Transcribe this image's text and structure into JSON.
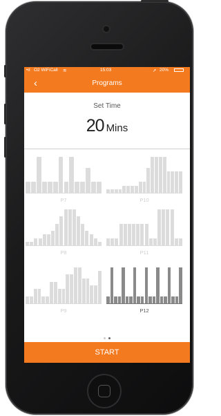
{
  "status_bar": {
    "carrier": "O2 WiFiCall",
    "time": "15:03",
    "battery": "20%"
  },
  "nav": {
    "title": "Programs",
    "back_icon": "chevron-left-icon"
  },
  "set_time": {
    "label": "Set Time",
    "value": "20",
    "unit": "Mins"
  },
  "programs": [
    {
      "id": "P7",
      "label": "P7",
      "selected": false,
      "levels": [
        3,
        3,
        10,
        3,
        3,
        3,
        10,
        3,
        10,
        3,
        3,
        7,
        3,
        3
      ]
    },
    {
      "id": "P10",
      "label": "P10",
      "selected": false,
      "levels": [
        1,
        1,
        1,
        1,
        2,
        2,
        2,
        2,
        3,
        3,
        7,
        10,
        10,
        10,
        10,
        6,
        6,
        6,
        6
      ]
    },
    {
      "id": "P8",
      "label": "P8",
      "selected": false,
      "levels": [
        1,
        1,
        2,
        2,
        3,
        3,
        4,
        6,
        8,
        10,
        10,
        10,
        8,
        6,
        4,
        3,
        2,
        1
      ]
    },
    {
      "id": "P11",
      "label": "P11",
      "selected": false,
      "levels": [
        2,
        2,
        2,
        6,
        6,
        6,
        6,
        6,
        6,
        6,
        2,
        2,
        10,
        10,
        10,
        10,
        2,
        2
      ]
    },
    {
      "id": "P9",
      "label": "P9",
      "selected": false,
      "levels": [
        2,
        2,
        4,
        4,
        2,
        2,
        6,
        6,
        4,
        4,
        8,
        8,
        10,
        10,
        7,
        7,
        5,
        5,
        9
      ]
    },
    {
      "id": "P12",
      "label": "P12",
      "selected": true,
      "levels": [
        2,
        10,
        2,
        2,
        10,
        2,
        2,
        10,
        2,
        2,
        10,
        2,
        2,
        10,
        2,
        2,
        10,
        2,
        2,
        10
      ]
    }
  ],
  "pagination": {
    "pages": 2,
    "current": 2
  },
  "start_button": {
    "label": "START"
  },
  "colors": {
    "accent": "#f47a20",
    "bar": "#dcdcdc",
    "bar_selected": "#8a8a8a"
  }
}
